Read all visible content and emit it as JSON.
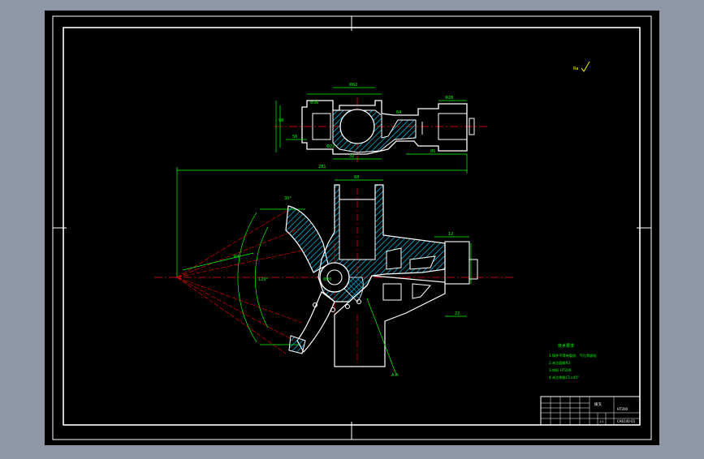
{
  "colors": {
    "background_outer": "#8f97a6",
    "canvas": "#000000",
    "border": "#ffffff",
    "dimension": "#00ff00",
    "centerline": "#ff0000",
    "hatch": "#00c8ff",
    "outline": "#ffffff",
    "note_text": "#00ff00",
    "roughness": "#ffff00"
  },
  "drawing": {
    "roughness_label": "Ra",
    "notes_title": "技术要求",
    "notes": [
      "1.铸件不得有裂纹、气孔等缺陷",
      "2.未注圆角R3",
      "3.材料 HT200",
      "4.未注倒角C1×45°"
    ],
    "dims_top": [
      "Φ62",
      "Φ36",
      "98",
      "32",
      "Φ28",
      "85",
      "Φ22",
      "64",
      "56"
    ],
    "dims_main": [
      "281",
      "68",
      "R4",
      "12",
      "Φ20",
      "30°",
      "22",
      "120°"
    ],
    "section_label": "A-A",
    "title_block": {
      "part_name": "拨叉",
      "drawing_no": "CA6140-01",
      "scale": "1:1",
      "material": "HT200"
    }
  }
}
